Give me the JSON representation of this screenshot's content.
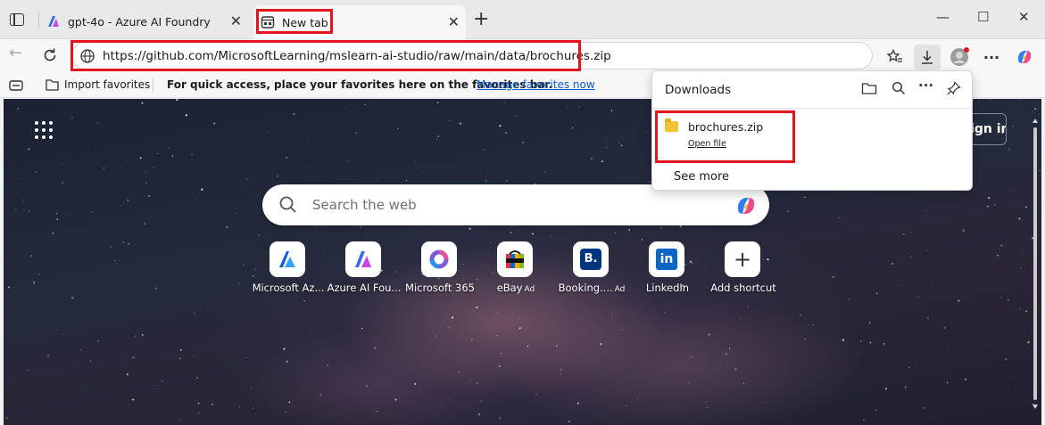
{
  "tabs": [
    {
      "title": "gpt-4o - Azure AI Foundry",
      "close": "✕"
    },
    {
      "title": "New tab",
      "close": "✕"
    }
  ],
  "window": {
    "new_tab": "+",
    "minimize": "—",
    "maximize": "☐",
    "close": "✕"
  },
  "address_bar": {
    "url": "https://github.com/MicrosoftLearning/mslearn-ai-studio/raw/main/data/brochures.zip"
  },
  "favorites_bar": {
    "import_label": "Import favorites",
    "hint": "For quick access, place your favorites here on the favorites bar.",
    "manage_link": "Manage favorites now"
  },
  "newtab": {
    "signin_label": "Sign in",
    "search_placeholder": "Search the web",
    "shortcuts": [
      {
        "label": "Microsoft Az...",
        "ad": "",
        "icon": "azure-icon"
      },
      {
        "label": "Azure AI Fou...",
        "ad": "",
        "icon": "azure-ai-foundry-icon"
      },
      {
        "label": "Microsoft 365",
        "ad": "",
        "icon": "microsoft-365-icon"
      },
      {
        "label": "eBay",
        "ad": "Ad",
        "icon": "ebay-icon"
      },
      {
        "label": "Booking....",
        "ad": "Ad",
        "icon": "booking-icon"
      },
      {
        "label": "LinkedIn",
        "ad": "",
        "icon": "linkedin-icon"
      },
      {
        "label": "Add shortcut",
        "ad": "",
        "icon": "plus-icon"
      }
    ]
  },
  "downloads": {
    "title": "Downloads",
    "file_name": "brochures.zip",
    "open_file": "Open file",
    "see_more": "See more"
  },
  "colors": {
    "highlight": "#e3141b",
    "link": "#0b5bd3",
    "accent": "#0078d4"
  }
}
